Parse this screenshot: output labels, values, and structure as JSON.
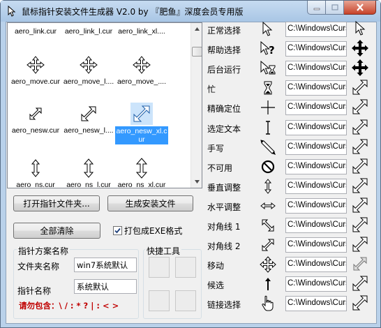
{
  "window": {
    "title": "鼠标指针安装文件生成器 V2.0  by 『肥鱼』深度会员专用版"
  },
  "cursor_list": {
    "items": [
      {
        "label": "aero_link.cur",
        "icon": "none"
      },
      {
        "label": "aero_link_l.cur",
        "icon": "none"
      },
      {
        "label": "aero_link_xl....",
        "icon": "none"
      },
      {
        "label": "aero_move.cur",
        "icon": "move-icon"
      },
      {
        "label": "aero_move_l....",
        "icon": "move-icon"
      },
      {
        "label": "aero_move_....",
        "icon": "move-icon"
      },
      {
        "label": "aero_nesw.cur",
        "icon": "diag-nesw-icon"
      },
      {
        "label": "aero_nesw_l....",
        "icon": "diag-nesw-icon"
      },
      {
        "label": "aero_nesw_xl.cur",
        "icon": "diag-nesw-icon",
        "selected": true
      },
      {
        "label": "aero_ns.cur",
        "icon": "vert-icon"
      },
      {
        "label": "aero_ns_l.cur",
        "icon": "vert-icon"
      },
      {
        "label": "aero_ns_xl.cur",
        "icon": "vert-icon"
      }
    ]
  },
  "buttons": {
    "open_folder": "打开指针文件夹...",
    "generate": "生成安装文件",
    "clear_all": "全部清除"
  },
  "pack_exe": {
    "label": "打包成EXE格式",
    "checked": true
  },
  "scheme_group": {
    "title": "指针方案名称",
    "folder_label": "文件夹名称",
    "folder_value": "win7系统默认",
    "pointer_label": "指针名称",
    "pointer_value": "系统默认"
  },
  "quick_tools": {
    "title": "快捷工具"
  },
  "warning": "请勿包含：\\ / : * ? | : < >",
  "roles": [
    {
      "label": "正常选择",
      "icon": "arrow-cursor-icon",
      "path": "C:\\Windows\\Curs",
      "btn": "arrow-btn-icon"
    },
    {
      "label": "帮助选择",
      "icon": "help-cursor-icon",
      "path": "C:\\Windows\\Curs",
      "btn": "move-btn-icon"
    },
    {
      "label": "后台运行",
      "icon": "busy-arrow-cursor-icon",
      "path": "C:\\Windows\\Curs",
      "btn": "move-btn-icon"
    },
    {
      "label": "忙",
      "icon": "hourglass-cursor-icon",
      "path": "C:\\Windows\\Curs",
      "btn": "resize-btn-icon"
    },
    {
      "label": "精确定位",
      "icon": "crosshair-cursor-icon",
      "path": "C:\\Windows\\Curs",
      "btn": "resize-btn-icon"
    },
    {
      "label": "选定文本",
      "icon": "ibeam-cursor-icon",
      "path": "C:\\Windows\\Curs",
      "btn": "resize-btn-icon"
    },
    {
      "label": "手写",
      "icon": "pen-cursor-icon",
      "path": "C:\\Windows\\Curs",
      "btn": "resize-btn-icon"
    },
    {
      "label": "不可用",
      "icon": "unavailable-cursor-icon",
      "path": "C:\\Windows\\Curs",
      "btn": "resize-btn-icon"
    },
    {
      "label": "垂直调整",
      "icon": "vert-resize-cursor-icon",
      "path": "C:\\Windows\\Curs",
      "btn": "resize-btn-icon"
    },
    {
      "label": "水平调整",
      "icon": "horz-resize-cursor-icon",
      "path": "C:\\Windows\\Curs",
      "btn": "resize-btn-icon"
    },
    {
      "label": "对角线 1",
      "icon": "diag1-resize-cursor-icon",
      "path": "C:\\Windows\\Curs",
      "btn": "resize-btn-icon"
    },
    {
      "label": "对角线 2",
      "icon": "diag2-resize-cursor-icon",
      "path": "C:\\Windows\\Curs",
      "btn": "resize-btn-icon"
    },
    {
      "label": "移动",
      "icon": "move-cursor-icon",
      "path": "C:\\Windows\\Curs",
      "btn": "resize-gray-btn-icon"
    },
    {
      "label": "候选",
      "icon": "up-arrow-cursor-icon",
      "path": "C:\\Windows\\Curs",
      "btn": "resize-btn-icon"
    },
    {
      "label": "链接选择",
      "icon": "hand-cursor-icon",
      "path": "C:\\Windows\\Curs",
      "btn": "resize-btn-icon"
    }
  ]
}
